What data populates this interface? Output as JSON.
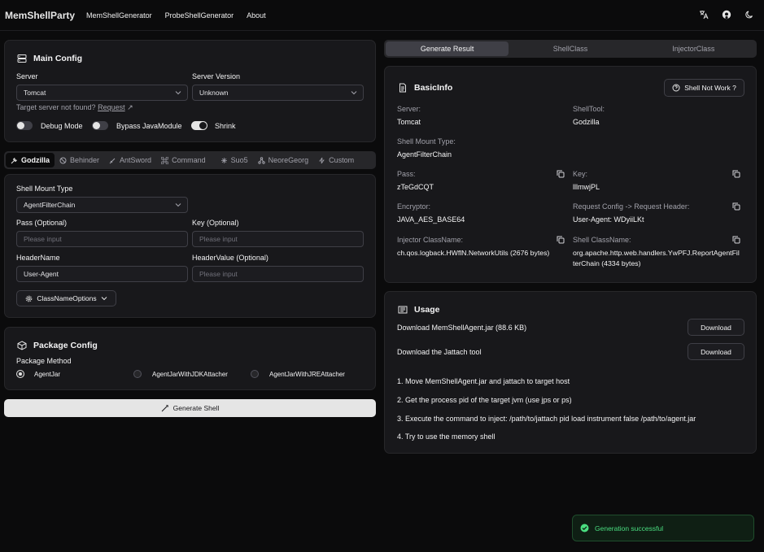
{
  "nav": {
    "brand": "MemShellParty",
    "links": [
      "MemShellGenerator",
      "ProbeShellGenerator",
      "About"
    ]
  },
  "main_config": {
    "title": "Main Config",
    "server_label": "Server",
    "server_value": "Tomcat",
    "version_label": "Server Version",
    "version_value": "Unknown",
    "not_found": "Target server not found?",
    "request_link": "Request",
    "debug_label": "Debug Mode",
    "bypass_label": "Bypass JavaModule",
    "shrink_label": "Shrink",
    "debug_on": false,
    "bypass_on": false,
    "shrink_on": true
  },
  "tool_tabs": [
    "Godzilla",
    "Behinder",
    "AntSword",
    "Command",
    "Suo5",
    "NeoreGeorg",
    "Custom"
  ],
  "shell": {
    "mount_label": "Shell Mount Type",
    "mount_value": "AgentFilterChain",
    "pass_label": "Pass (Optional)",
    "key_label": "Key (Optional)",
    "placeholder": "Please input",
    "header_name_label": "HeaderName",
    "header_name_value": "User-Agent",
    "header_value_label": "HeaderValue (Optional)",
    "classname_options": "ClassNameOptions"
  },
  "package": {
    "title": "Package Config",
    "method_label": "Package Method",
    "options": [
      "AgentJar",
      "AgentJarWithJDKAttacher",
      "AgentJarWithJREAttacher"
    ],
    "selected": "AgentJar"
  },
  "generate_label": "Generate Shell",
  "result_tabs": [
    "Generate Result",
    "ShellClass",
    "InjectorClass"
  ],
  "basic": {
    "title": "BasicInfo",
    "not_work": "Shell Not Work ?",
    "server_label": "Server:",
    "server": "Tomcat",
    "tool_label": "ShellTool:",
    "tool": "Godzilla",
    "mount_label": "Shell Mount Type:",
    "mount": "AgentFilterChain",
    "pass_label": "Pass:",
    "pass": "zTeGdCQT",
    "key_label": "Key:",
    "key": "lllmwjPL",
    "enc_label": "Encryptor:",
    "enc": "JAVA_AES_BASE64",
    "req_label": "Request Config -> Request Header:",
    "req": "User-Agent: WDyiiLKt",
    "inj_label": "Injector ClassName:",
    "inj": "ch.qos.logback.HWflN.NetworkUtils (2676 bytes)",
    "cls_label": "Shell ClassName:",
    "cls_line1": "org.apache.http.web.handlers.YwPFJ.ReportAgentFil",
    "cls_line2": "terChain (4334 bytes)"
  },
  "usage": {
    "title": "Usage",
    "dl_agent": "Download MemShellAgent.jar (88.6 KB)",
    "dl_jattach": "Download the Jattach tool",
    "dl_btn": "Download",
    "steps": [
      "1. Move MemShellAgent.jar and jattach to target host",
      "2. Get the process pid of the target jvm (use jps or ps)",
      "3. Execute the command to inject: /path/to/jattach pid load instrument false /path/to/agent.jar",
      "4. Try to use the memory shell"
    ]
  },
  "toast": "Generation successful",
  "colors": {
    "success": "#4ade80",
    "background": "#0b0b0c",
    "card": "#18181b"
  }
}
